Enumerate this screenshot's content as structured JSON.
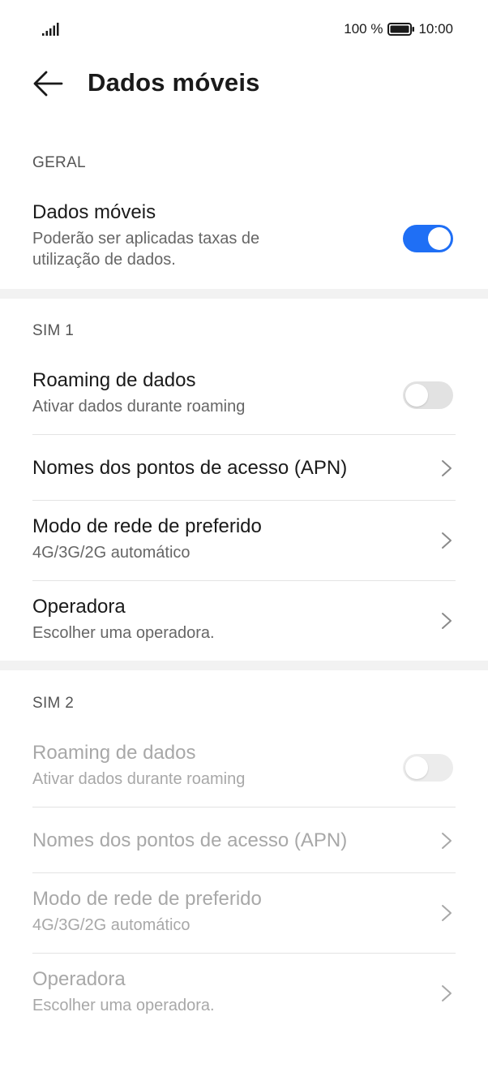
{
  "status_bar": {
    "battery_percent": "100 %",
    "time": "10:00"
  },
  "header": {
    "title": "Dados móveis"
  },
  "general": {
    "section_label": "GERAL",
    "mobile_data": {
      "title": "Dados móveis",
      "subtitle": "Poderão ser aplicadas taxas de utilização de dados.",
      "enabled": true
    }
  },
  "sim1": {
    "section_label": "SIM 1",
    "roaming": {
      "title": "Roaming de dados",
      "subtitle": "Ativar dados durante roaming",
      "enabled": false
    },
    "apn": {
      "title": "Nomes dos pontos de acesso (APN)"
    },
    "network_mode": {
      "title": "Modo de rede de preferido",
      "subtitle": "4G/3G/2G automático"
    },
    "operator": {
      "title": "Operadora",
      "subtitle": "Escolher uma operadora."
    }
  },
  "sim2": {
    "section_label": "SIM 2",
    "roaming": {
      "title": "Roaming de dados",
      "subtitle": "Ativar dados durante roaming",
      "enabled": false
    },
    "apn": {
      "title": "Nomes dos pontos de acesso (APN)"
    },
    "network_mode": {
      "title": "Modo de rede de preferido",
      "subtitle": "4G/3G/2G automático"
    },
    "operator": {
      "title": "Operadora",
      "subtitle": "Escolher uma operadora."
    }
  },
  "colors": {
    "accent": "#1f6ff5",
    "toggle_off": "#e2e2e2",
    "disabled_text": "#a8a8a8"
  }
}
